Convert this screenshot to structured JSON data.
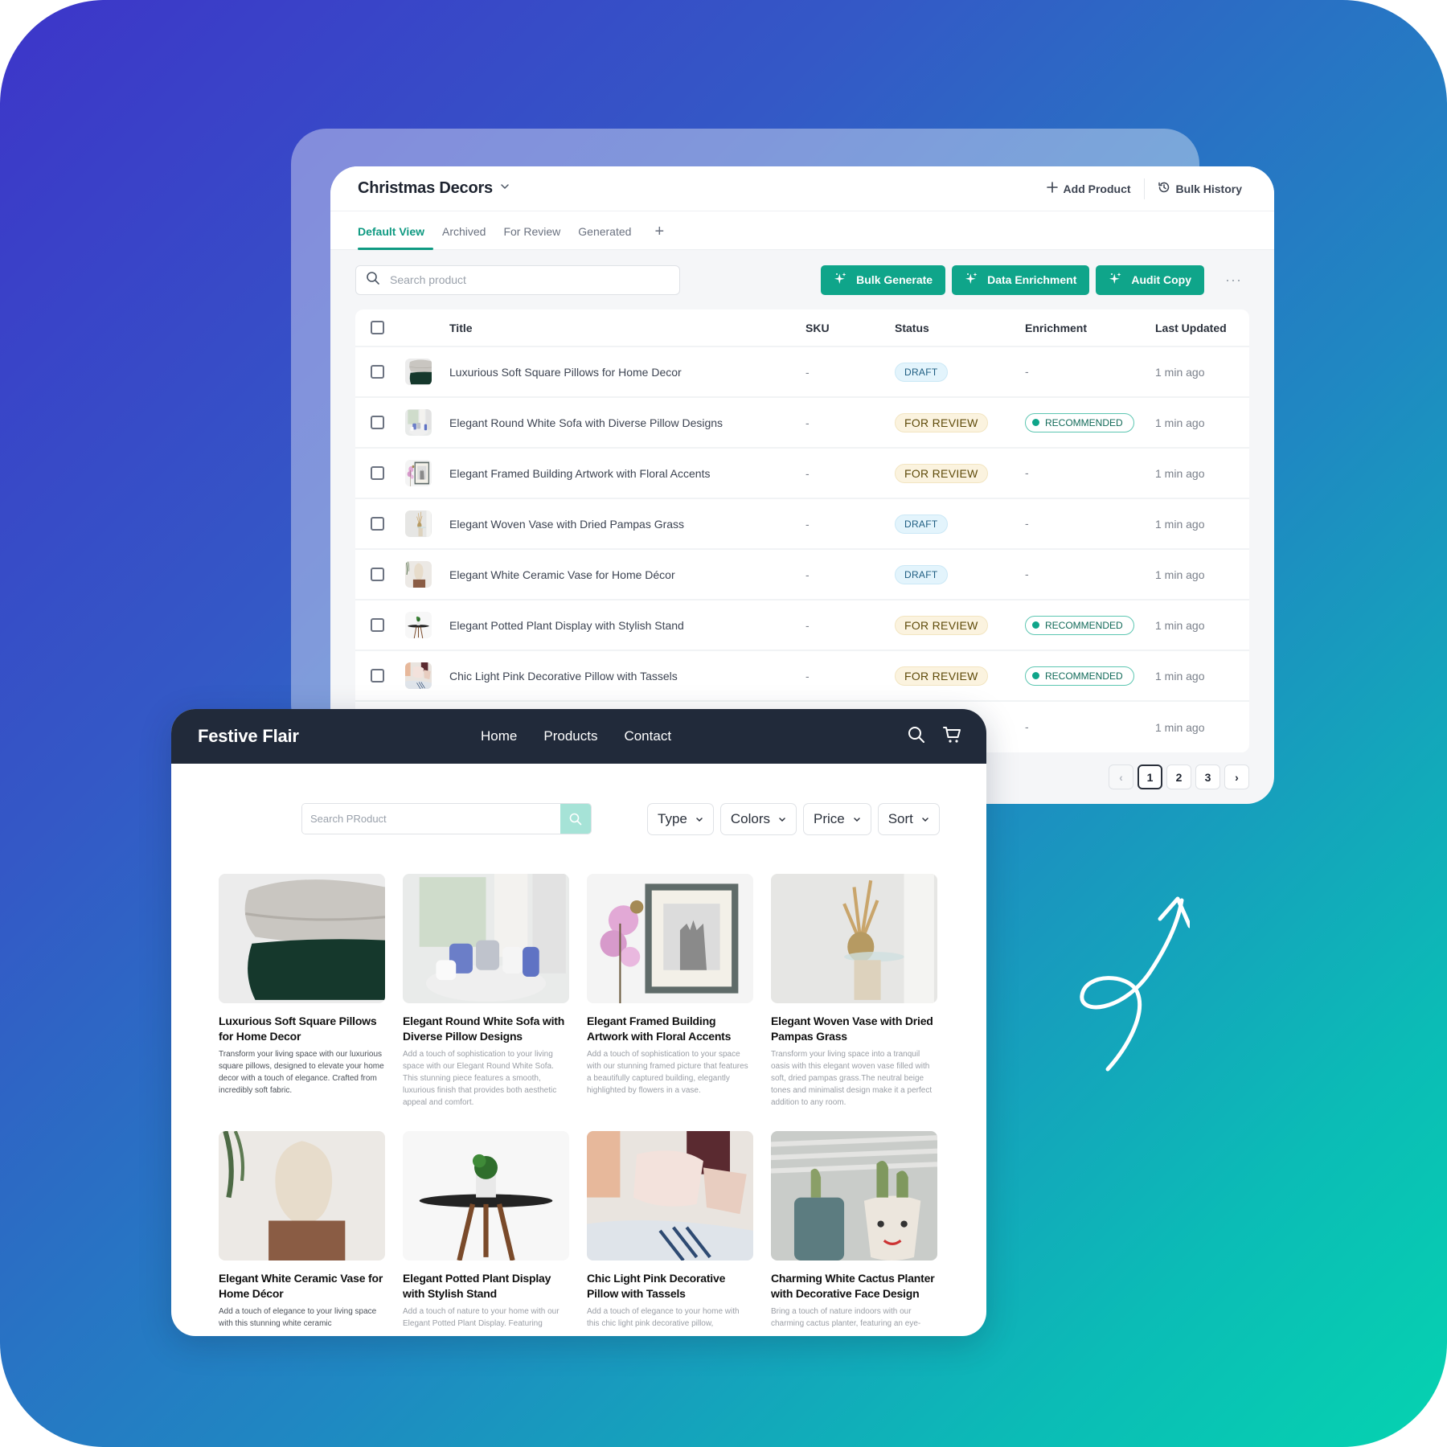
{
  "colors": {
    "accent": "#0fa58a",
    "nav_bg": "#212a3a",
    "draft_bg": "#e3f4fc",
    "review_bg": "#fbf3df"
  },
  "admin": {
    "collection_name": "Christmas Decors",
    "header_actions": [
      {
        "label": "Add Product",
        "icon": "plus-icon"
      },
      {
        "label": "Bulk History",
        "icon": "history-icon"
      }
    ],
    "tabs": [
      {
        "label": "Default View",
        "active": true
      },
      {
        "label": "Archived",
        "active": false
      },
      {
        "label": "For Review",
        "active": false
      },
      {
        "label": "Generated",
        "active": false
      }
    ],
    "add_tab_label": "+",
    "search_placeholder": "Search product",
    "action_buttons": [
      {
        "label": "Bulk Generate",
        "icon": "sparkle-icon"
      },
      {
        "label": "Data Enrichment",
        "icon": "sparkle-icon"
      },
      {
        "label": "Audit Copy",
        "icon": "sparkle-icon"
      }
    ],
    "more_label": "···",
    "table": {
      "columns": [
        "Title",
        "SKU",
        "Status",
        "Enrichment",
        "Last Updated"
      ],
      "rows": [
        {
          "title": "Luxurious Soft Square Pillows for Home Decor",
          "sku": "-",
          "status": "DRAFT",
          "enrichment": "-",
          "updated": "1 min ago",
          "thumb": "pillows"
        },
        {
          "title": "Elegant Round White Sofa with Diverse Pillow Designs",
          "sku": "-",
          "status": "FOR REVIEW",
          "enrichment": "RECOMMENDED",
          "updated": "1 min ago",
          "thumb": "sofa"
        },
        {
          "title": "Elegant Framed Building Artwork with Floral Accents",
          "sku": "-",
          "status": "FOR REVIEW",
          "enrichment": "-",
          "updated": "1 min ago",
          "thumb": "frame"
        },
        {
          "title": "Elegant Woven Vase with Dried Pampas Grass",
          "sku": "-",
          "status": "DRAFT",
          "enrichment": "-",
          "updated": "1 min ago",
          "thumb": "pampas"
        },
        {
          "title": "Elegant White Ceramic Vase for Home Décor",
          "sku": "-",
          "status": "DRAFT",
          "enrichment": "-",
          "updated": "1 min ago",
          "thumb": "vase"
        },
        {
          "title": "Elegant Potted Plant Display with Stylish Stand",
          "sku": "-",
          "status": "FOR REVIEW",
          "enrichment": "RECOMMENDED",
          "updated": "1 min ago",
          "thumb": "plant"
        },
        {
          "title": "Chic Light Pink Decorative Pillow with Tassels",
          "sku": "-",
          "status": "FOR REVIEW",
          "enrichment": "RECOMMENDED",
          "updated": "1 min ago",
          "thumb": "pinkpillow"
        },
        {
          "title": "",
          "sku": "",
          "status": "",
          "enrichment": "-",
          "updated": "1 min ago",
          "thumb": ""
        }
      ]
    },
    "pagination": {
      "pages": [
        "1",
        "2",
        "3"
      ],
      "current": "1",
      "prev": "‹",
      "next": "›"
    }
  },
  "store": {
    "brand": "Festive Flair",
    "nav_links": [
      "Home",
      "Products",
      "Contact"
    ],
    "search_placeholder": "Search PRoduct",
    "filters": [
      "Type",
      "Colors",
      "Price",
      "Sort"
    ],
    "products": [
      {
        "title": "Luxurious Soft Square Pillows for Home Decor",
        "desc": "Transform your living space with our luxurious square pillows, designed to elevate your home decor with a touch of elegance. Crafted from incredibly soft fabric.",
        "img": "pillows",
        "dark": true
      },
      {
        "title": "Elegant Round White Sofa with Diverse Pillow Designs",
        "desc": "Add a touch of sophistication to your living space with our Elegant Round White Sofa. This stunning piece features a smooth, luxurious finish that provides both aesthetic appeal and comfort.",
        "img": "sofa",
        "dark": false
      },
      {
        "title": "Elegant Framed Building Artwork with Floral Accents",
        "desc": "Add a touch of sophistication to your space with our stunning framed picture that features a beautifully captured building, elegantly highlighted by flowers in a vase.",
        "img": "frame",
        "dark": false
      },
      {
        "title": "Elegant Woven Vase with Dried Pampas Grass",
        "desc": "Transform your living space into a tranquil oasis with this elegant woven vase filled with soft, dried pampas grass.The neutral beige tones and minimalist design make it a perfect addition to any room.",
        "img": "pampas",
        "dark": false
      },
      {
        "title": "Elegant White Ceramic Vase for Home Décor",
        "desc": "Add a touch of elegance to your living space with this stunning white ceramic",
        "img": "vase",
        "dark": true
      },
      {
        "title": "Elegant Potted Plant Display with Stylish Stand",
        "desc": "Add a touch of nature to your home with our Elegant Potted Plant Display. Featuring",
        "img": "plant",
        "dark": false
      },
      {
        "title": "Chic Light Pink Decorative Pillow with Tassels",
        "desc": "Add a touch of elegance to your home with this chic light pink decorative pillow,",
        "img": "pinkpillow",
        "dark": false
      },
      {
        "title": "Charming White Cactus Planter with Decorative Face Design",
        "desc": "Bring a touch of nature indoors with our charming cactus planter, featuring an eye-",
        "img": "cactus",
        "dark": false
      }
    ]
  }
}
